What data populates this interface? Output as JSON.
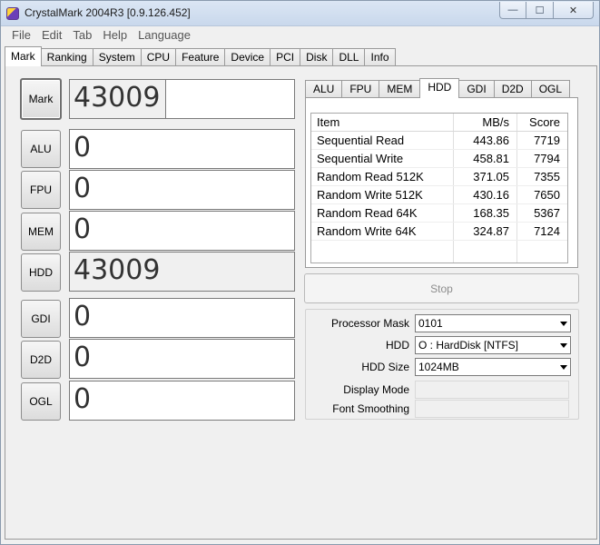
{
  "window": {
    "title": "CrystalMark 2004R3 [0.9.126.452]",
    "minimize": "—",
    "maximize": "☐",
    "close": "✕"
  },
  "menu": [
    "File",
    "Edit",
    "Tab",
    "Help",
    "Language"
  ],
  "main_tabs": [
    "Mark",
    "Ranking",
    "System",
    "CPU",
    "Feature",
    "Device",
    "PCI",
    "Disk",
    "DLL",
    "Info"
  ],
  "scores": {
    "mark": {
      "label": "Mark",
      "value": "43009"
    },
    "alu": {
      "label": "ALU",
      "value": "0"
    },
    "fpu": {
      "label": "FPU",
      "value": "0"
    },
    "mem": {
      "label": "MEM",
      "value": "0"
    },
    "hdd": {
      "label": "HDD",
      "value": "43009"
    },
    "gdi": {
      "label": "GDI",
      "value": "0"
    },
    "d2d": {
      "label": "D2D",
      "value": "0"
    },
    "ogl": {
      "label": "OGL",
      "value": "0"
    }
  },
  "sub_tabs": [
    "ALU",
    "FPU",
    "MEM",
    "HDD",
    "GDI",
    "D2D",
    "OGL"
  ],
  "results": {
    "headers": {
      "item": "Item",
      "mbs": "MB/s",
      "score": "Score"
    },
    "rows": [
      {
        "item": "Sequential Read",
        "mbs": "443.86",
        "score": "7719"
      },
      {
        "item": "Sequential Write",
        "mbs": "458.81",
        "score": "7794"
      },
      {
        "item": "Random Read 512K",
        "mbs": "371.05",
        "score": "7355"
      },
      {
        "item": "Random Write 512K",
        "mbs": "430.16",
        "score": "7650"
      },
      {
        "item": "Random Read 64K",
        "mbs": "168.35",
        "score": "5367"
      },
      {
        "item": "Random Write 64K",
        "mbs": "324.87",
        "score": "7124"
      }
    ]
  },
  "stop_label": "Stop",
  "settings": {
    "processor_mask": {
      "label": "Processor Mask",
      "value": "0101"
    },
    "hdd": {
      "label": "HDD",
      "value": "O : HardDisk [NTFS]"
    },
    "hdd_size": {
      "label": "HDD Size",
      "value": "1024MB"
    },
    "display_mode": {
      "label": "Display Mode"
    },
    "font_smoothing": {
      "label": "Font Smoothing"
    }
  }
}
